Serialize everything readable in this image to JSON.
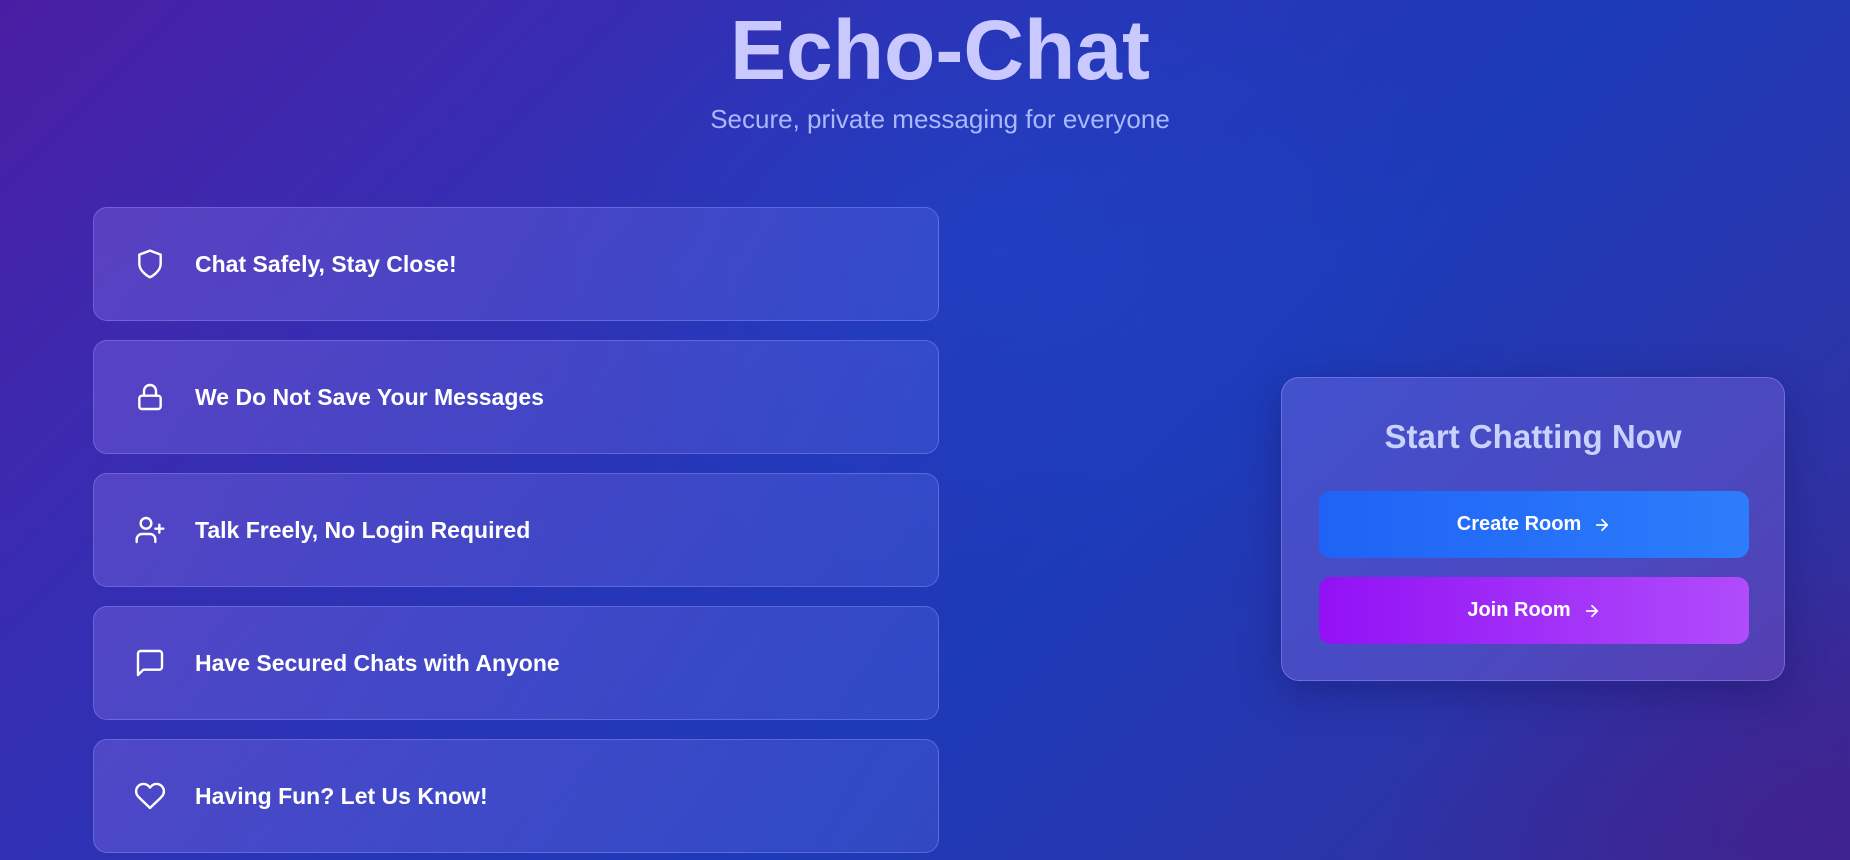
{
  "hero": {
    "title": "Echo-Chat",
    "subtitle": "Secure, private messaging for everyone"
  },
  "features": [
    {
      "icon": "shield-icon",
      "label": "Chat Safely, Stay Close!"
    },
    {
      "icon": "lock-icon",
      "label": "We Do Not Save Your Messages"
    },
    {
      "icon": "user-plus-icon",
      "label": "Talk Freely, No Login Required"
    },
    {
      "icon": "message-square-icon",
      "label": "Have Secured Chats with Anyone"
    },
    {
      "icon": "heart-icon",
      "label": "Having Fun? Let Us Know!"
    }
  ],
  "card": {
    "title": "Start Chatting Now",
    "create_label": "Create Room",
    "join_label": "Join Room"
  },
  "colors": {
    "create_button": "#2470f9",
    "join_button": "#a12ef8",
    "title": "#c9c8ff"
  }
}
